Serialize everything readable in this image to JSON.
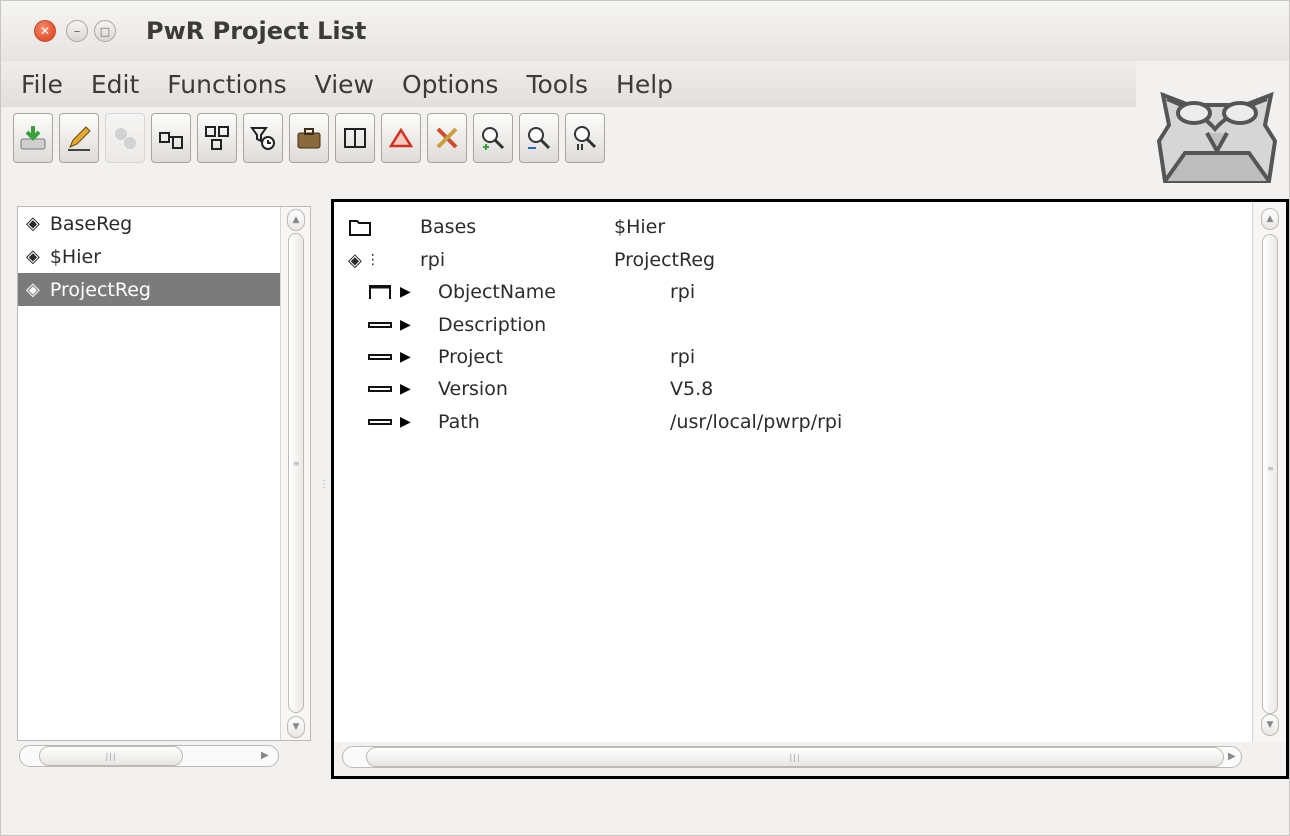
{
  "window": {
    "title": "PwR Project List"
  },
  "menu": [
    "File",
    "Edit",
    "Functions",
    "View",
    "Options",
    "Tools",
    "Help"
  ],
  "toolbar": {
    "buttons": [
      {
        "icon": "save-icon",
        "glyph": "⤓",
        "enabled": true
      },
      {
        "icon": "edit-pencil-icon",
        "glyph": "✎",
        "enabled": true
      },
      {
        "icon": "gears-icon",
        "glyph": "⚙",
        "enabled": false
      },
      {
        "icon": "build-node-icon",
        "glyph": "⌂",
        "enabled": true
      },
      {
        "icon": "distribute-icon",
        "glyph": "⊞",
        "enabled": true
      },
      {
        "icon": "filter-clock-icon",
        "glyph": "⏲",
        "enabled": true
      },
      {
        "icon": "suitcase-icon",
        "glyph": "⛁",
        "enabled": true
      },
      {
        "icon": "split-view-icon",
        "glyph": "◫",
        "enabled": true
      },
      {
        "icon": "triangle-alert-icon",
        "glyph": "△",
        "enabled": true
      },
      {
        "icon": "tools-icon",
        "glyph": "✂",
        "enabled": true
      },
      {
        "icon": "zoom-in-icon",
        "glyph": "⊕",
        "enabled": true
      },
      {
        "icon": "zoom-out-icon",
        "glyph": "⊖",
        "enabled": true
      },
      {
        "icon": "zoom-reset-icon",
        "glyph": "⊙",
        "enabled": true
      }
    ]
  },
  "left_tree": {
    "items": [
      {
        "label": "BaseReg",
        "selected": false
      },
      {
        "label": "$Hier",
        "selected": false
      },
      {
        "label": "ProjectReg",
        "selected": true
      }
    ]
  },
  "right_tree": {
    "rows": [
      {
        "name": "Bases",
        "value": "$Hier"
      },
      {
        "name": "rpi",
        "value": "ProjectReg"
      }
    ],
    "attributes": [
      {
        "name": "ObjectName",
        "value": "rpi"
      },
      {
        "name": "Description",
        "value": ""
      },
      {
        "name": "Project",
        "value": "rpi"
      },
      {
        "name": "Version",
        "value": "V5.8"
      },
      {
        "name": "Path",
        "value": "/usr/local/pwrp/rpi"
      }
    ]
  },
  "colors": {
    "selection": "#7b7b7b",
    "close_button": "#e0532f",
    "panel_border": "#000000"
  }
}
